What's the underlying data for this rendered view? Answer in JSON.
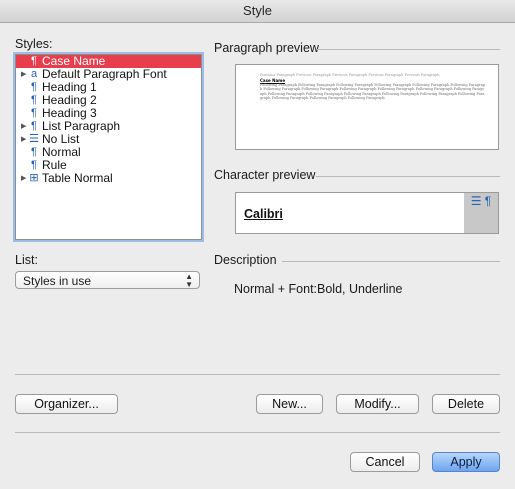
{
  "window": {
    "title": "Style"
  },
  "styles": {
    "label": "Styles:",
    "items": [
      {
        "label": "Case Name",
        "icon": "paragraph-icon",
        "glyph": "¶",
        "expander": false,
        "selected": true
      },
      {
        "label": "Default Paragraph Font",
        "icon": "character-style-icon",
        "glyph": "a",
        "expander": true,
        "selected": false
      },
      {
        "label": "Heading 1",
        "icon": "paragraph-icon",
        "glyph": "¶",
        "expander": false,
        "selected": false
      },
      {
        "label": "Heading 2",
        "icon": "paragraph-icon",
        "glyph": "¶",
        "expander": false,
        "selected": false
      },
      {
        "label": "Heading 3",
        "icon": "paragraph-icon",
        "glyph": "¶",
        "expander": false,
        "selected": false
      },
      {
        "label": "List Paragraph",
        "icon": "paragraph-icon",
        "glyph": "¶",
        "expander": true,
        "selected": false
      },
      {
        "label": "No List",
        "icon": "list-style-icon",
        "glyph": "☰",
        "expander": true,
        "selected": false
      },
      {
        "label": "Normal",
        "icon": "paragraph-icon",
        "glyph": "¶",
        "expander": false,
        "selected": false
      },
      {
        "label": "Rule",
        "icon": "paragraph-icon",
        "glyph": "¶",
        "expander": false,
        "selected": false
      },
      {
        "label": "Table Normal",
        "icon": "table-style-icon",
        "glyph": "⊞",
        "expander": true,
        "selected": false
      }
    ]
  },
  "paragraph_preview": {
    "label": "Paragraph preview",
    "sample_case": "Case Name",
    "filler_before": "Previous Paragraph Previous Paragraph Previous Paragraph Previous Paragraph Previous Paragraph",
    "filler_after": "Following Paragraph Following Paragraph Following Paragraph Following Paragraph Following Paragraph Following Paragraph Following Paragraph Following Paragraph Following Paragraph Following Paragraph Following Paragraph Following Paragraph Following Paragraph Following Paragraph Following Paragraph Following Paragraph Following Paragraph Following Paragraph Following Paragraph Following Paragraph Following Paragraph"
  },
  "character_preview": {
    "label": "Character preview",
    "sample": "Calibri",
    "side_icons": "☰ ¶"
  },
  "list": {
    "label": "List:",
    "selected": "Styles in use"
  },
  "description": {
    "label": "Description",
    "text": "Normal + Font:Bold, Underline"
  },
  "buttons": {
    "organizer": "Organizer...",
    "new": "New...",
    "modify": "Modify...",
    "delete": "Delete",
    "cancel": "Cancel",
    "apply": "Apply"
  },
  "colors": {
    "selection": "#e83d4c",
    "focus_ring": "#9bbde6",
    "primary_button": "#6ea5ef",
    "icon_blue": "#2a63b8"
  }
}
